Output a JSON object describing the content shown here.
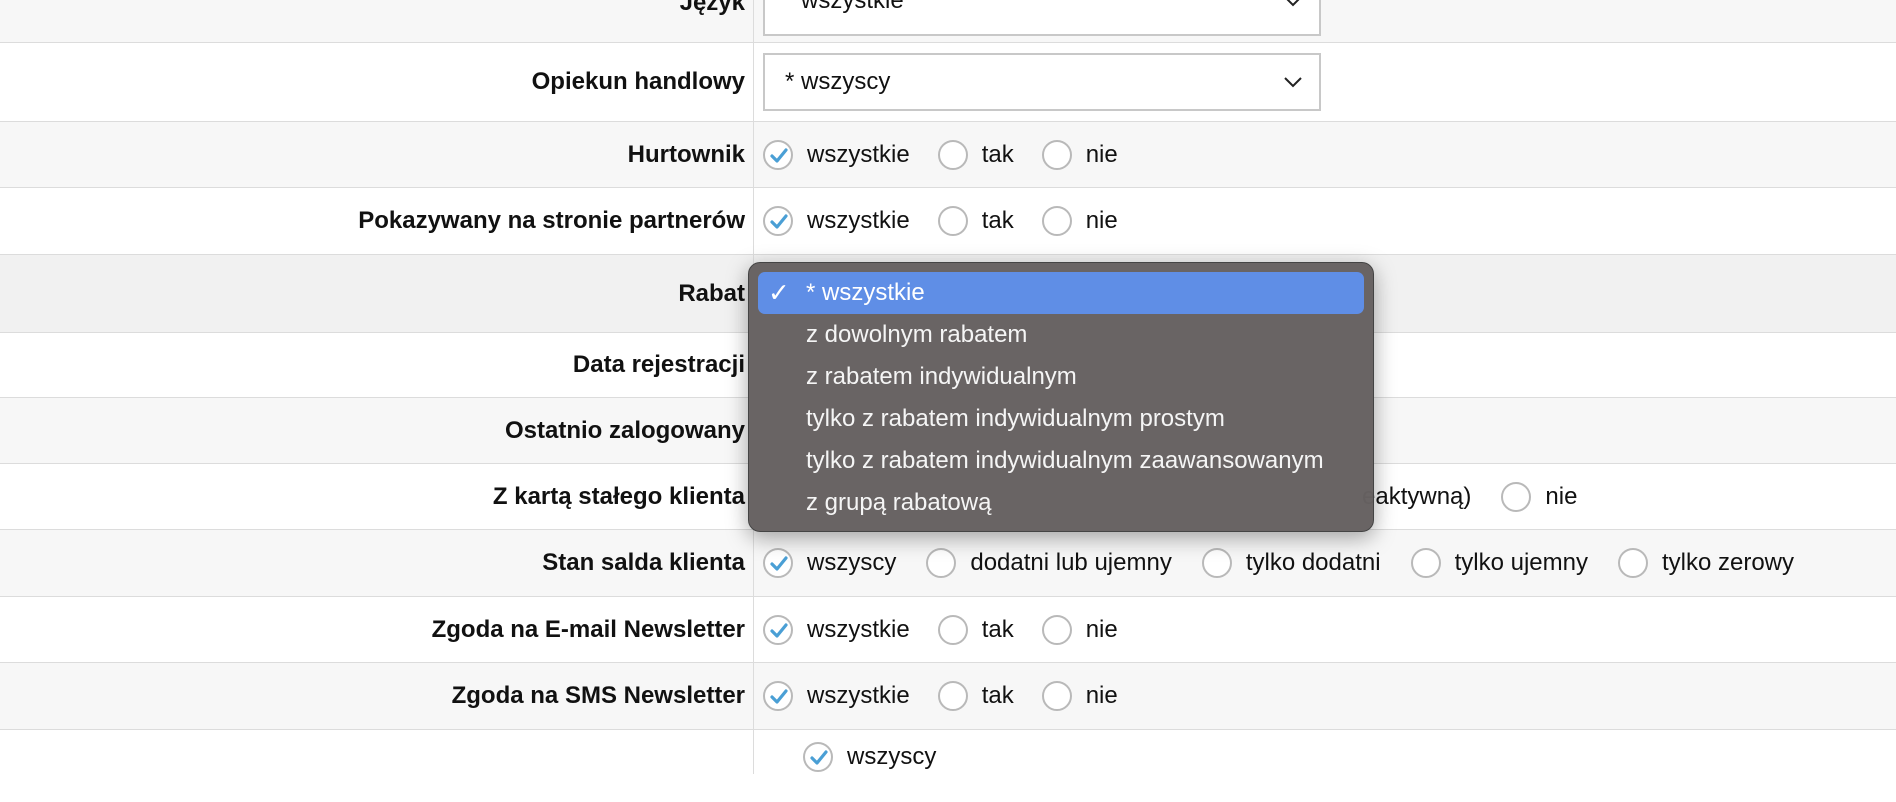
{
  "rows": {
    "jezyk": {
      "label": "Język",
      "value": "* wszystkie"
    },
    "opiekun": {
      "label": "Opiekun handlowy",
      "value": "* wszyscy"
    },
    "hurtownik": {
      "label": "Hurtownik",
      "options": [
        "wszystkie",
        "tak",
        "nie"
      ],
      "selected": 0
    },
    "pokazywany": {
      "label": "Pokazywany na stronie partnerów",
      "options": [
        "wszystkie",
        "tak",
        "nie"
      ],
      "selected": 0
    },
    "rabat": {
      "label": "Rabat"
    },
    "data_rejestracji": {
      "label": "Data rejestracji"
    },
    "ostatnio": {
      "label": "Ostatnio zalogowany"
    },
    "karta": {
      "label": "Z kartą stałego klienta",
      "partial_option": "eaktywną)",
      "option_nie": "nie"
    },
    "saldo": {
      "label": "Stan salda klienta",
      "options": [
        "wszyscy",
        "dodatni lub ujemny",
        "tylko dodatni",
        "tylko ujemny",
        "tylko zerowy"
      ],
      "selected": 0
    },
    "email_newsletter": {
      "label": "Zgoda na E-mail Newsletter",
      "options": [
        "wszystkie",
        "tak",
        "nie"
      ],
      "selected": 0
    },
    "sms_newsletter": {
      "label": "Zgoda na SMS Newsletter",
      "options": [
        "wszystkie",
        "tak",
        "nie"
      ],
      "selected": 0
    },
    "last": {
      "option": "wszyscy"
    }
  },
  "rabat_dropdown": {
    "options": [
      "* wszystkie",
      "z dowolnym rabatem",
      "z rabatem indywidualnym",
      "tylko z rabatem indywidualnym prostym",
      "tylko z rabatem indywidualnym zaawansowanym",
      "z grupą rabatową"
    ],
    "selected_index": 0,
    "tick": "✓"
  },
  "icons": {
    "chevron": "chevron-down-icon",
    "check": "check-icon"
  },
  "colors": {
    "accent": "#5f8ee6",
    "check": "#4a9fd5",
    "menu_bg": "#666161"
  }
}
